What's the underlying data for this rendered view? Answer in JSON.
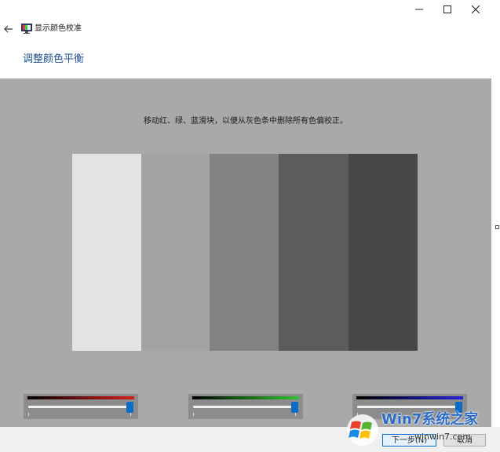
{
  "window": {
    "app_title": "显示颜色校准"
  },
  "page": {
    "title": "调整颜色平衡",
    "instruction": "移动红、绿、蓝滑块，以便从灰色条中删除所有色偏校正。"
  },
  "gray_bars": [
    {
      "color": "#e4e4e4"
    },
    {
      "color": "#a3a3a3"
    },
    {
      "color": "#828282"
    },
    {
      "color": "#5c5c5c"
    },
    {
      "color": "#474747"
    }
  ],
  "sliders": [
    {
      "channel": "red",
      "gradient_color": "#d42020",
      "value_percent": 100
    },
    {
      "channel": "green",
      "gradient_color": "#2ec62e",
      "value_percent": 100
    },
    {
      "channel": "blue",
      "gradient_color": "#2424d8",
      "value_percent": 100
    }
  ],
  "buttons": {
    "next": "下一步(N)",
    "cancel": "取消"
  },
  "watermark": {
    "brand": "Win7系统之家",
    "url": "winwin7.com"
  },
  "icons": {
    "back": "back-arrow-icon",
    "app": "display-calibration-icon",
    "minimize": "minimize-icon",
    "maximize": "maximize-icon",
    "close": "close-icon"
  },
  "colors": {
    "accent": "#1d4f91",
    "content_bg": "#a9a9a9",
    "slider_thumb": "#0b6bc9"
  }
}
